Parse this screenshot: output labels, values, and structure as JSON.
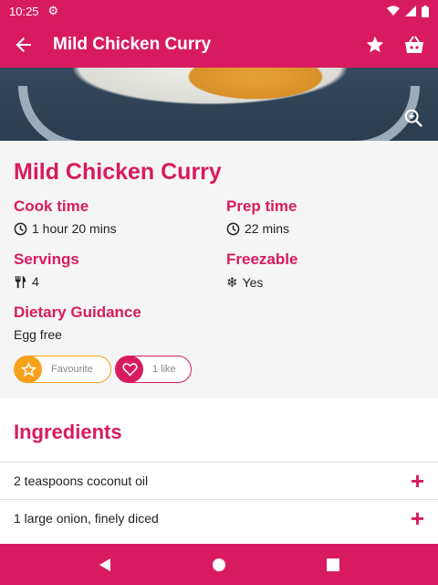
{
  "status_bar": {
    "time": "10:25"
  },
  "app_bar": {
    "title": "Mild Chicken Curry"
  },
  "recipe": {
    "title": "Mild Chicken Curry",
    "cook_time_label": "Cook time",
    "cook_time_value": "1 hour 20 mins",
    "prep_time_label": "Prep time",
    "prep_time_value": "22 mins",
    "servings_label": "Servings",
    "servings_value": "4",
    "freezable_label": "Freezable",
    "freezable_value": "Yes",
    "dietary_label": "Dietary Guidance",
    "dietary_value": "Egg free"
  },
  "actions": {
    "favourite_label": "Favourite",
    "like_label": "1 like"
  },
  "ingredients": {
    "title": "Ingredients",
    "items": [
      "2 teaspoons coconut oil",
      "1 large onion, finely diced"
    ]
  },
  "colors": {
    "primary": "#d81b60",
    "accent": "#f7a11a"
  },
  "icons": [
    "back-arrow-icon",
    "star-icon",
    "basket-icon",
    "zoom-in-icon",
    "clock-icon",
    "cutlery-icon",
    "snowflake-icon",
    "heart-icon",
    "plus-icon"
  ]
}
